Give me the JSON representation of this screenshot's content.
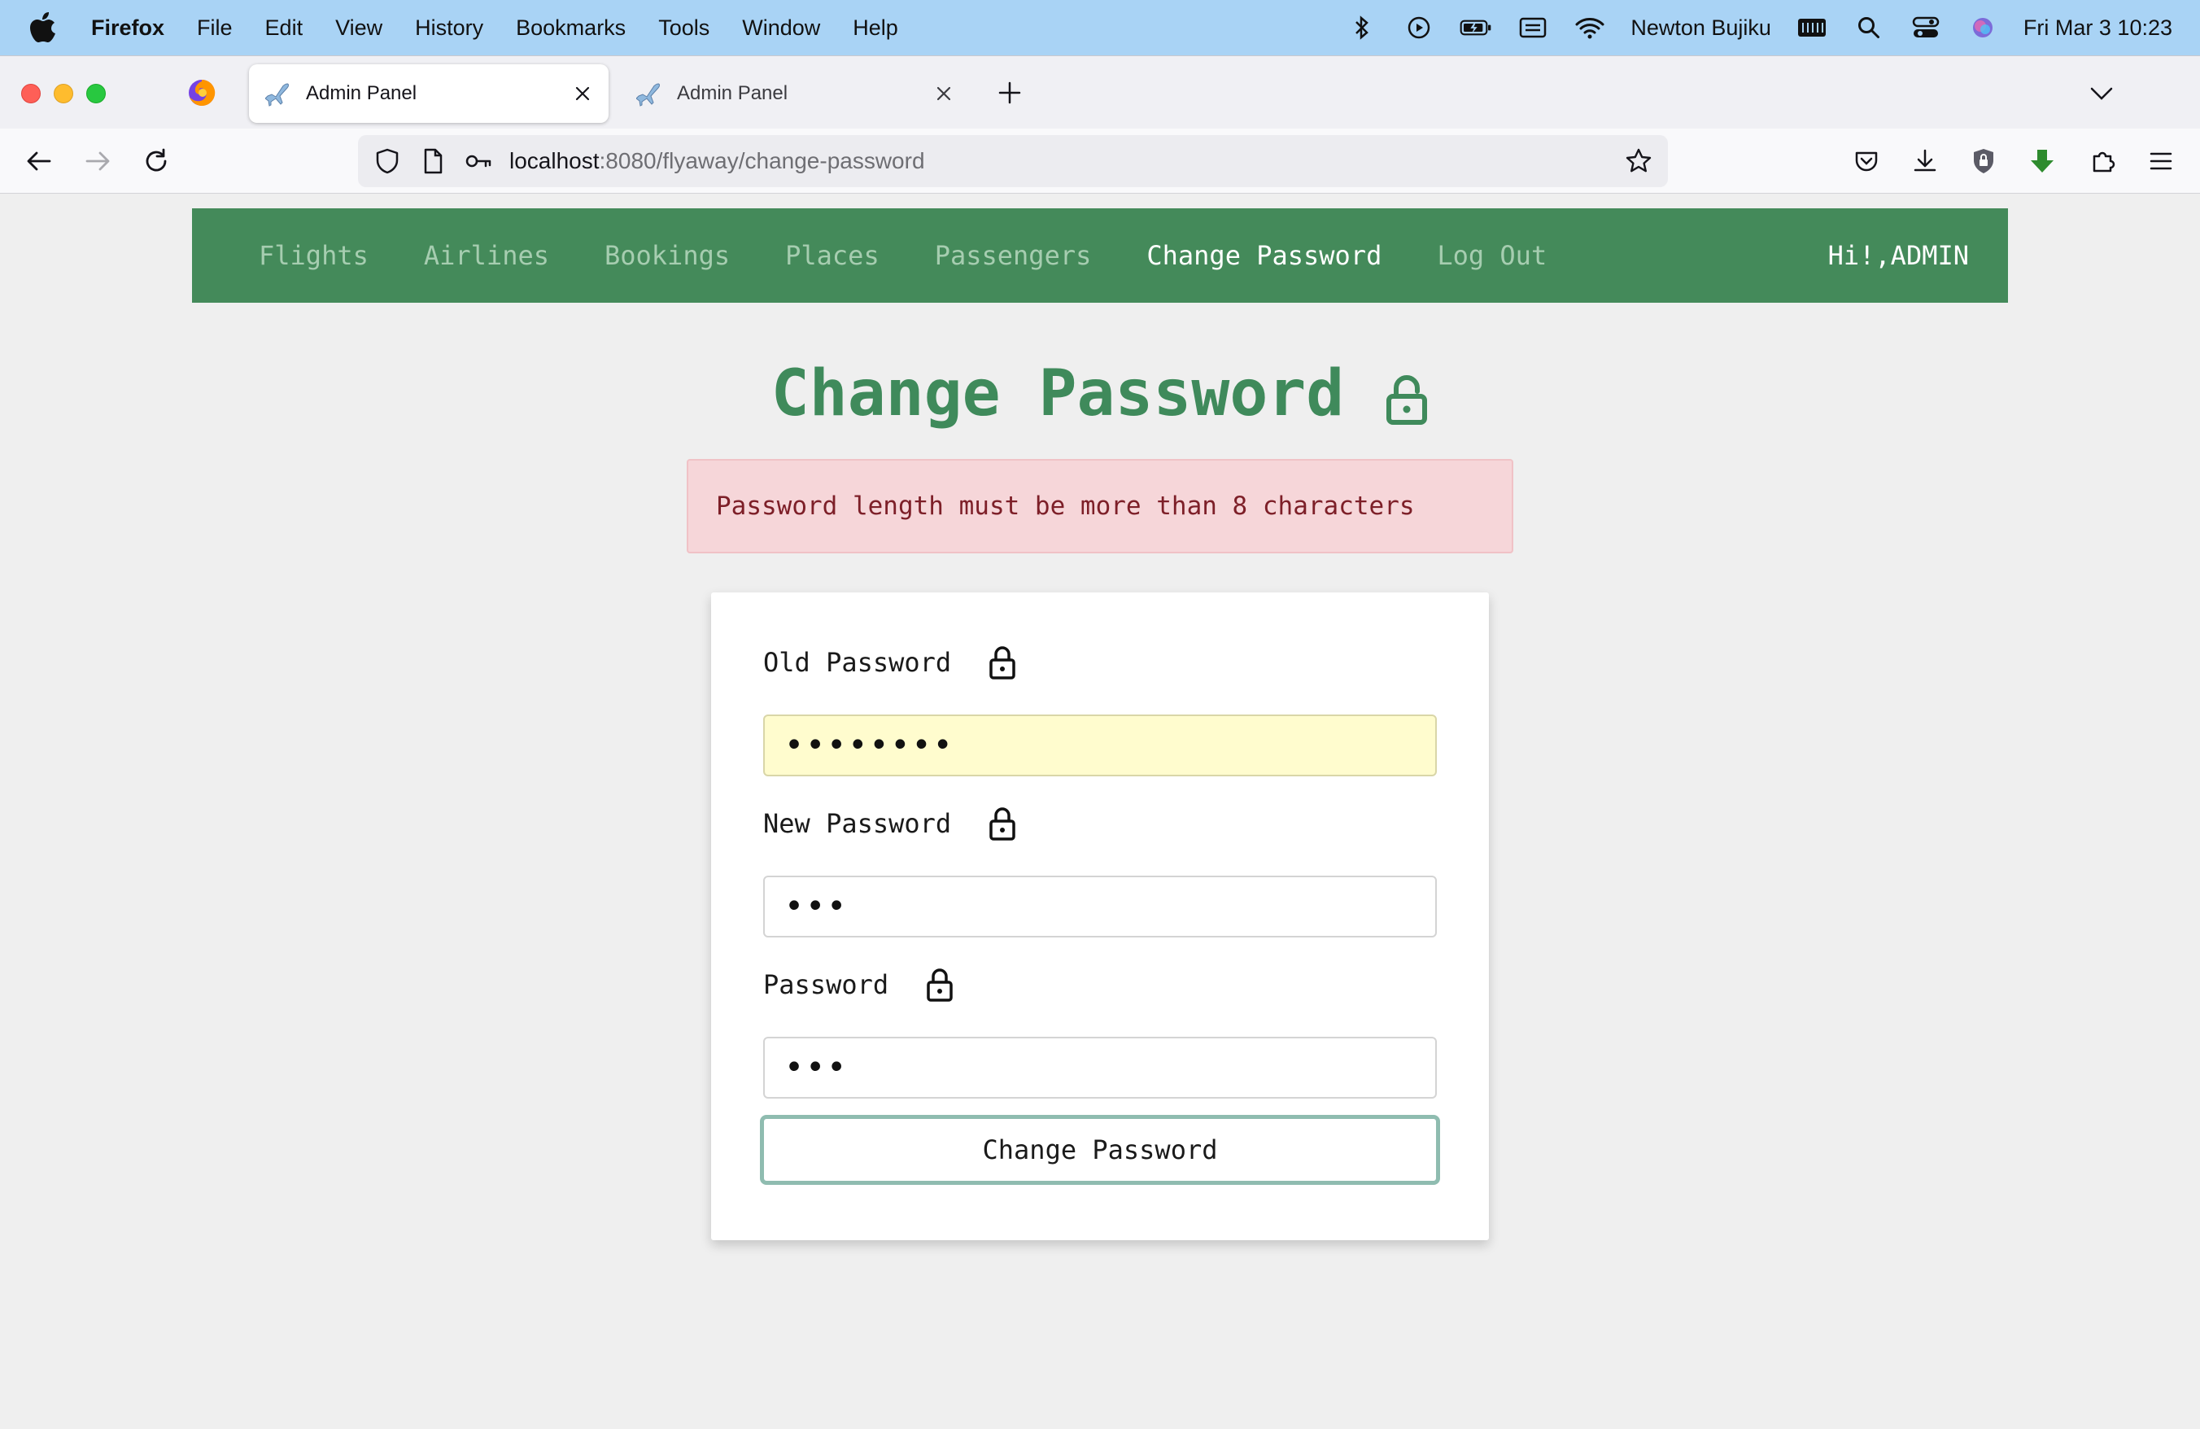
{
  "menubar": {
    "app": "Firefox",
    "items": [
      "File",
      "Edit",
      "View",
      "History",
      "Bookmarks",
      "Tools",
      "Window",
      "Help"
    ],
    "user": "Newton Bujiku",
    "clock": "Fri Mar 3  10:23"
  },
  "browser": {
    "tabs": [
      {
        "title": "Admin Panel",
        "active": true
      },
      {
        "title": "Admin Panel",
        "active": false
      }
    ],
    "url_host": "localhost",
    "url_rest": ":8080/flyaway/change-password"
  },
  "nav": {
    "links": [
      "Flights",
      "Airlines",
      "Bookings",
      "Places",
      "Passengers",
      "Change Password",
      "Log Out"
    ],
    "current": "Change Password",
    "greeting": "Hi!,ADMIN"
  },
  "main": {
    "title": "Change Password",
    "alert": "Password length must be more than 8 characters"
  },
  "form": {
    "old_label": "Old Password",
    "old_value": "••••••••",
    "new_label": "New Password",
    "new_value": "•••",
    "confirm_label": "Password",
    "confirm_value": "•••",
    "submit_label": "Change Password"
  },
  "colors": {
    "nav_bg": "#448a5a",
    "title": "#3f8a5b",
    "alert_bg": "#f6d6d9",
    "alert_text": "#7d1f28",
    "autofill_bg": "#fffcce",
    "menubar_bg": "#a9d3f5"
  },
  "icons": {
    "title": "lock-icon",
    "field": "lock-icon",
    "tab_favicon": "airplane-icon"
  }
}
